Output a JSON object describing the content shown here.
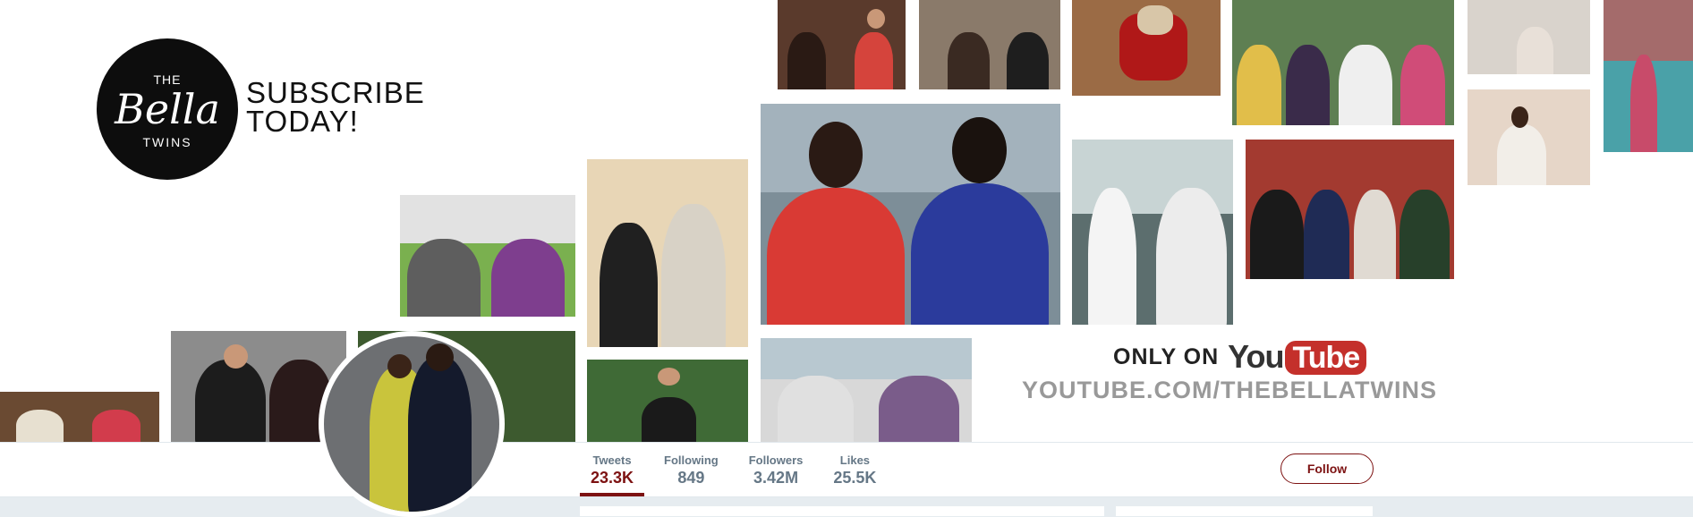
{
  "banner": {
    "logo": {
      "line1": "THE",
      "line2": "Bella",
      "line3": "TWINS"
    },
    "subscribe": {
      "line1": "SUBSCRIBE",
      "line2": "TODAY!"
    },
    "only_on": "ONLY ON",
    "youtube": {
      "you": "You",
      "tube": "Tube"
    },
    "url": "YOUTUBE.COM/THEBELLATWINS"
  },
  "profile": {
    "stats": [
      {
        "label": "Tweets",
        "value": "23.3K",
        "active": true
      },
      {
        "label": "Following",
        "value": "849"
      },
      {
        "label": "Followers",
        "value": "3.42M"
      },
      {
        "label": "Likes",
        "value": "25.5K"
      }
    ],
    "follow_label": "Follow"
  },
  "colors": {
    "accent": "#7d1212",
    "muted": "#657786",
    "youtube_red": "#c4302b",
    "page_bg": "#e6ecf0"
  }
}
